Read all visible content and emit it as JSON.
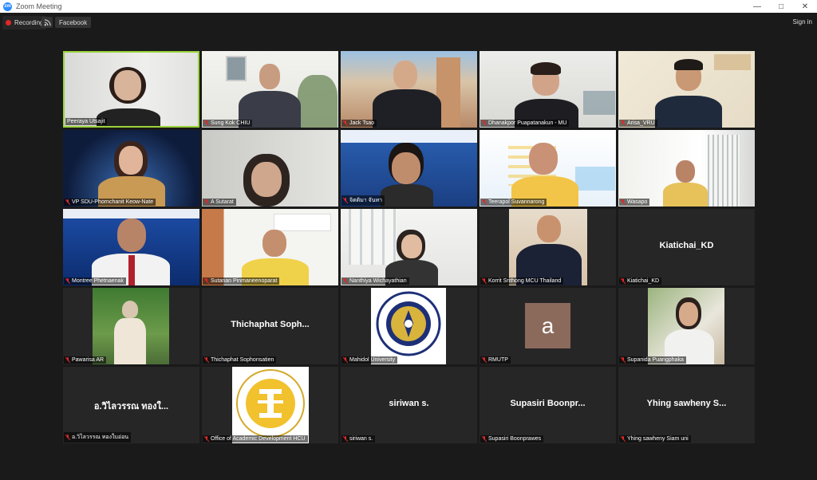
{
  "window": {
    "title": "Zoom Meeting"
  },
  "toolbar": {
    "recording_label": "Recording",
    "facebook_label": "Facebook",
    "signin_label": "Sign in"
  },
  "colors": {
    "active_speaker": "#9bd33a",
    "mic_muted": "#e02828",
    "tile_bg": "#262626"
  },
  "participants": [
    {
      "name": "Peeraya Utsajit",
      "active": true,
      "muted": false,
      "video": true
    },
    {
      "name": "Sung Kok CHIU",
      "muted": true,
      "video": true
    },
    {
      "name": "Jack Tsao",
      "muted": true,
      "video": true
    },
    {
      "name": "Dhanakpor Puapatanakun - MU",
      "muted": true,
      "video": true
    },
    {
      "name": "Arisa_VRU",
      "muted": true,
      "video": true
    },
    {
      "name": "VP SDU-Phornchanit Keow-Nate",
      "muted": true,
      "video": true
    },
    {
      "name": "A Sutarat",
      "muted": true,
      "video": true
    },
    {
      "name": "จิตติมา จันทา",
      "muted": true,
      "video": true
    },
    {
      "name": "Teerapol Suvannarong",
      "muted": true,
      "video": true
    },
    {
      "name": "Wasapo",
      "muted": true,
      "video": true
    },
    {
      "name": "Montree Phetnaenak",
      "muted": true,
      "video": true
    },
    {
      "name": "Sutanan Pinmaneenoparat",
      "muted": true,
      "video": true
    },
    {
      "name": "Nanthiya Wichayathian",
      "muted": true,
      "video": true
    },
    {
      "name": "Korrit Srithong MCU Thailand",
      "muted": true,
      "video": true
    },
    {
      "name": "Kiatichai_KD",
      "display": "Kiatichai_KD",
      "muted": true,
      "video": false
    },
    {
      "name": "Pawarisa AR",
      "muted": true,
      "video": true
    },
    {
      "name": "Thichaphat Sophonsatien",
      "display": "Thichaphat Soph...",
      "muted": true,
      "video": false
    },
    {
      "name": "Mahidol University",
      "muted": true,
      "video": true
    },
    {
      "name": "RMUTP",
      "avatar_letter": "a",
      "muted": true,
      "video": false
    },
    {
      "name": "Supanida Puangphaka",
      "muted": true,
      "video": true
    },
    {
      "name": "อ.วิไลวรรณ ทองใบอ่อน",
      "display": "อ.วิไลวรรณ ทองใ...",
      "muted": true,
      "video": false
    },
    {
      "name": "Office of Academic Development HCU",
      "muted": true,
      "video": true
    },
    {
      "name": "siriwan s.",
      "display": "siriwan s.",
      "muted": true,
      "video": false
    },
    {
      "name": "Supasiri Boonprawes",
      "display": "Supasiri Boonpr...",
      "muted": true,
      "video": false
    },
    {
      "name": "Yhing sawheny Siam uni",
      "display": "Yhing sawheny S...",
      "muted": true,
      "video": false
    }
  ]
}
